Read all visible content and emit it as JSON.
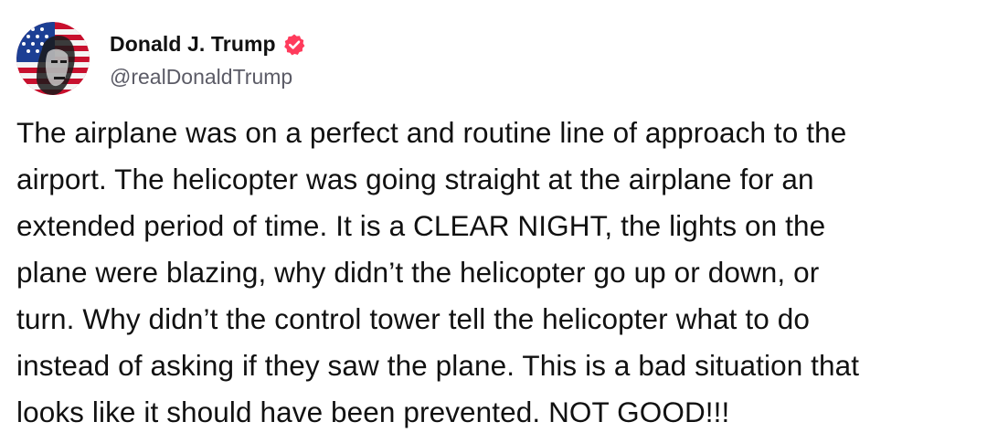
{
  "author": {
    "display_name": "Donald J. Trump",
    "handle": "@realDonaldTrump",
    "verified_icon": "verified-badge-icon",
    "badge_color": "#ff3b5c"
  },
  "post": {
    "lines": [
      "The airplane was on a perfect and routine line of approach to the",
      "airport. The helicopter was going straight at the airplane for an",
      "extended period of time. It is a CLEAR NIGHT, the lights on the",
      "plane were blazing, why didn’t the helicopter go up or down, or",
      "turn. Why didn’t the control tower tell the helicopter what to do",
      "instead of asking if they saw the plane. This is a bad situation that",
      "looks like it should have been prevented. NOT GOOD!!!"
    ]
  }
}
